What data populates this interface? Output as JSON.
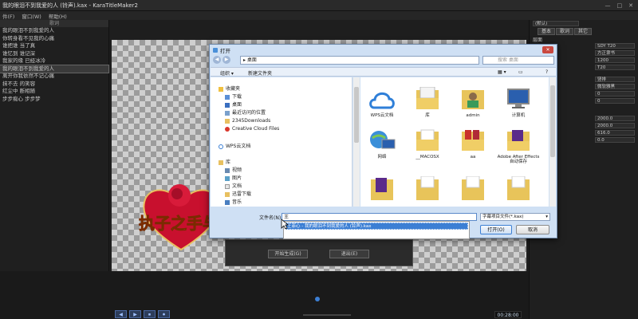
{
  "app": {
    "title": "我的眼泪不到我爱的人 (铃声).kax - KaraTitleMaker2",
    "menu": [
      "件(F)",
      "窗口(W)",
      "帮助(H)"
    ],
    "window_controls": [
      "—",
      "□",
      "✕"
    ]
  },
  "lyrics": {
    "header": "歌词",
    "lines": [
      "我的眼泪不到我爱的人",
      "你转身看不见我的心痛",
      "谁把谁 当了真",
      "谁忆到 谁记深",
      "我家的缘 已经冰冷",
      "我的眼泪不到我爱的人",
      "离开你我依然不记心痛",
      "抹不去 的笑容",
      "红尘中 断相随",
      "步步痴心 步步梦"
    ],
    "selected_index": 5
  },
  "stage": {
    "artwork_text": "执子之手与子偕老",
    "buttons": [
      "开始生成(G)",
      "退出(E)"
    ]
  },
  "props": {
    "title": "(默认)",
    "tabs": [
      "基本",
      "歌词",
      "其它"
    ],
    "section": "层面",
    "values": [
      "SDY T20",
      "方正隶书",
      "1200",
      "T20",
      "竖排",
      "微软雅黑",
      "0",
      "0",
      "2000.0",
      "2000.0",
      "616.0",
      "0.0"
    ]
  },
  "timeline": {
    "transport": [
      "◀",
      "▶",
      "⏹",
      "⏺"
    ],
    "timecode": "00:28:00"
  },
  "dialog": {
    "title": "打开",
    "address": "桌面",
    "search_placeholder": "搜索 桌面",
    "toolbar": {
      "organize": "组织 ▾",
      "new_folder": "新建文件夹"
    },
    "nav": {
      "favorites": "收藏夹",
      "favorites_items": [
        "下载",
        "桌面",
        "最近访问的位置",
        "2345Downloads",
        "Creative Cloud Files"
      ],
      "wps": "WPS云文档",
      "libraries": "库",
      "library_items": [
        "视频",
        "图片",
        "文档",
        "迅雷下载",
        "音乐"
      ]
    },
    "files": [
      "WPS云文档",
      "库",
      "admin",
      "计算机",
      "网络",
      "__MACOSX",
      "aa",
      "Adobe After Effects 自动保存",
      "",
      "",
      "",
      ""
    ],
    "filename_label": "文件名(N):",
    "filename_value": "王",
    "suggestion": "王菲心 - 我的眼泪不到我爱的人 (铃声).kax",
    "filetype": "字幕项目文件(*.kax)",
    "open_label": "打开(O)",
    "cancel_label": "取消"
  },
  "colors": {
    "accent": "#3c7fd4",
    "dark_bg": "#1e1e1e",
    "dialog_bg": "#cfe0f4"
  }
}
